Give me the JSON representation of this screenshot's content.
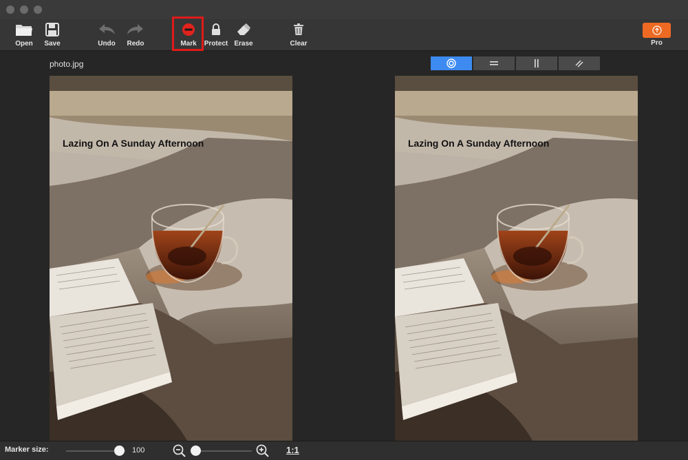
{
  "window": {
    "traffic_lights": [
      "close",
      "minimize",
      "zoom"
    ]
  },
  "toolbar": {
    "open_label": "Open",
    "save_label": "Save",
    "undo_label": "Undo",
    "redo_label": "Redo",
    "mark_label": "Mark",
    "protect_label": "Protect",
    "erase_label": "Erase",
    "clear_label": "Clear",
    "pro_label": "Pro",
    "selected_tool": "Mark",
    "pro_color": "#ee6a22",
    "highlight_color": "#e01a1a"
  },
  "content": {
    "filename": "photo.jpg",
    "view_modes": [
      "target-icon",
      "horizontal-split-icon",
      "vertical-split-icon",
      "diagonal-split-icon"
    ],
    "active_mode": "target-icon",
    "active_mode_color": "#3d8bf0",
    "left_overlay_text": "Lazing On A Sunday Afternoon",
    "right_overlay_text": "Lazing On A Sunday Afternoon"
  },
  "bottombar": {
    "marker_size_label": "Marker size:",
    "marker_size_value": "100",
    "marker_size_fraction": 0.9,
    "zoom_fraction": 0.05,
    "actual_size_label": "1:1"
  }
}
